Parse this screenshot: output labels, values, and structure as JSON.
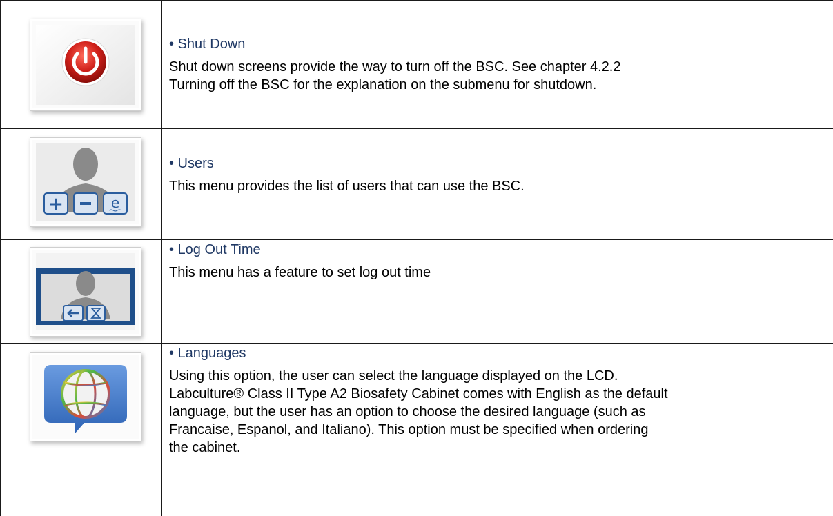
{
  "items": [
    {
      "icon": "power-icon",
      "heading": "• Shut Down",
      "lines": [
        "Shut down screens provide the way to turn off the BSC. See chapter 4.2.2",
        "Turning off the BSC for the explanation on the submenu for shutdown."
      ]
    },
    {
      "icon": "users-icon",
      "heading": "• Users",
      "lines": [
        "This menu provides the list of users that can use the BSC."
      ]
    },
    {
      "icon": "logout-time-icon",
      "heading": "• Log Out Time",
      "lines": [
        "This menu has a feature to set log out time"
      ]
    },
    {
      "icon": "languages-globe-icon",
      "heading": "• Languages",
      "lines": [
        "Using this option, the user can select the language displayed on the LCD.",
        "Labculture® Class II Type A2 Biosafety Cabinet comes with English as the default",
        "language, but the user has an option to choose the desired language (such as",
        "Francaise, Espanol, and Italiano). This option must be specified when ordering",
        "the cabinet."
      ]
    }
  ],
  "colors": {
    "heading": "#1f3864",
    "power_red": "#d0201a",
    "icon_gray": "#8a8a8a",
    "button_blue": "#2a5d9e",
    "globe_panel": "#3f78c8"
  }
}
